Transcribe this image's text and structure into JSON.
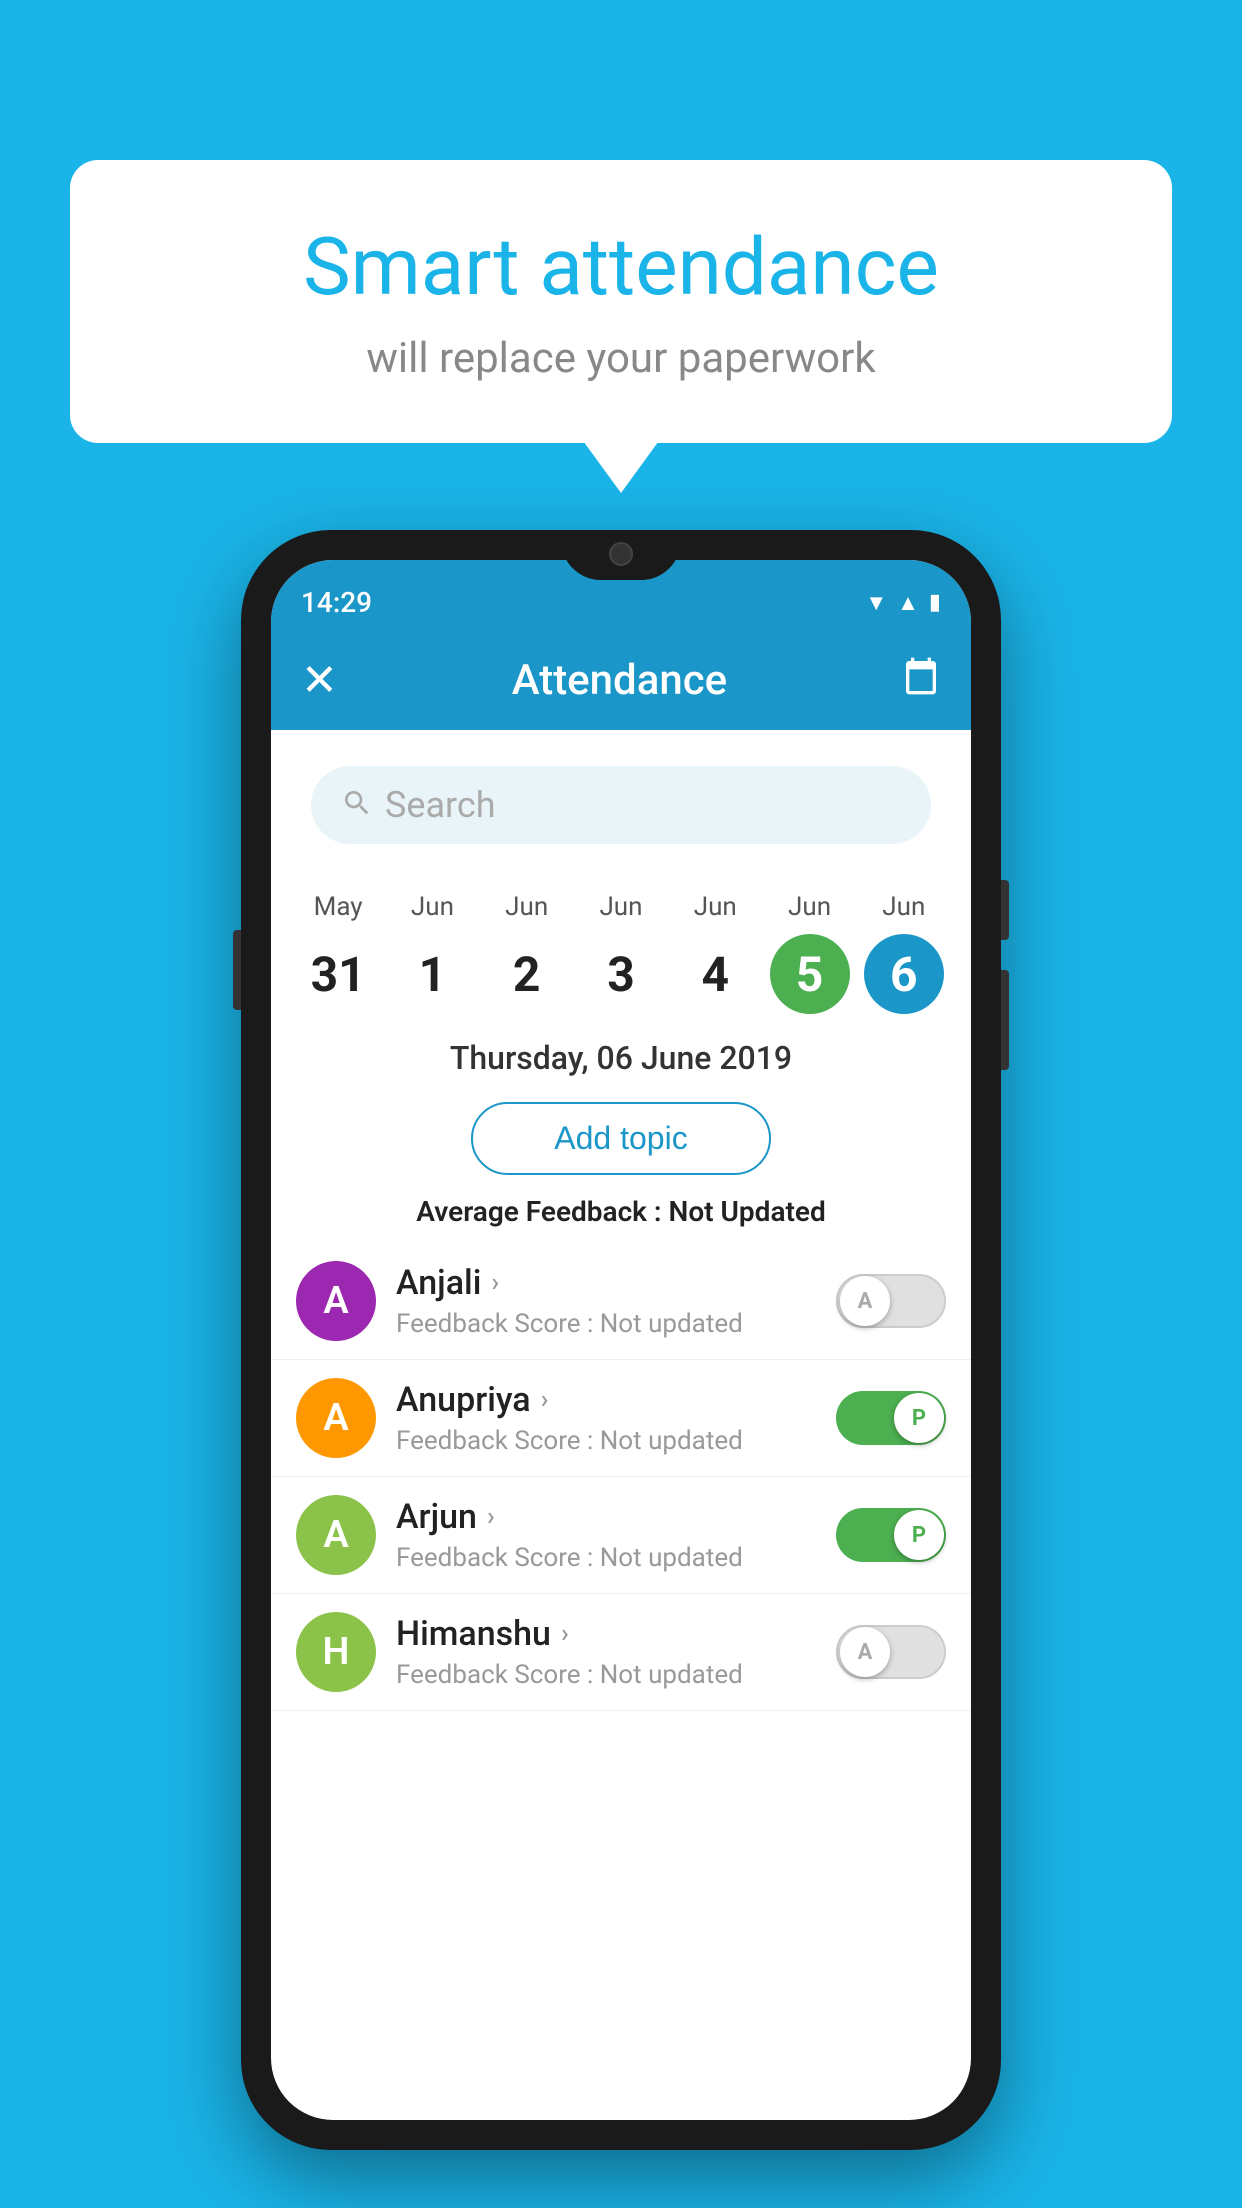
{
  "background_color": "#1ab4e8",
  "speech_bubble": {
    "title": "Smart attendance",
    "subtitle": "will replace your paperwork"
  },
  "status_bar": {
    "time": "14:29",
    "wifi": "▼",
    "signal": "▲",
    "battery": "▮"
  },
  "app_bar": {
    "title": "Attendance",
    "close_label": "✕",
    "calendar_icon": "📅"
  },
  "search": {
    "placeholder": "Search"
  },
  "calendar": {
    "days": [
      {
        "month": "May",
        "num": "31",
        "state": "normal"
      },
      {
        "month": "Jun",
        "num": "1",
        "state": "normal"
      },
      {
        "month": "Jun",
        "num": "2",
        "state": "normal"
      },
      {
        "month": "Jun",
        "num": "3",
        "state": "normal"
      },
      {
        "month": "Jun",
        "num": "4",
        "state": "normal"
      },
      {
        "month": "Jun",
        "num": "5",
        "state": "today"
      },
      {
        "month": "Jun",
        "num": "6",
        "state": "selected"
      }
    ]
  },
  "selected_date": "Thursday, 06 June 2019",
  "add_topic_label": "Add topic",
  "average_feedback": {
    "label": "Average Feedback : ",
    "value": "Not Updated"
  },
  "students": [
    {
      "name": "Anjali",
      "avatar_letter": "A",
      "avatar_color": "#9c27b0",
      "feedback_label": "Feedback Score : ",
      "feedback_value": "Not updated",
      "toggle": "off",
      "toggle_letter": "A"
    },
    {
      "name": "Anupriya",
      "avatar_letter": "A",
      "avatar_color": "#ff9800",
      "feedback_label": "Feedback Score : ",
      "feedback_value": "Not updated",
      "toggle": "on",
      "toggle_letter": "P"
    },
    {
      "name": "Arjun",
      "avatar_letter": "A",
      "avatar_color": "#8bc34a",
      "feedback_label": "Feedback Score : ",
      "feedback_value": "Not updated",
      "toggle": "on",
      "toggle_letter": "P"
    },
    {
      "name": "Himanshu",
      "avatar_letter": "H",
      "avatar_color": "#8bc34a",
      "feedback_label": "Feedback Score : ",
      "feedback_value": "Not updated",
      "toggle": "off",
      "toggle_letter": "A"
    }
  ]
}
